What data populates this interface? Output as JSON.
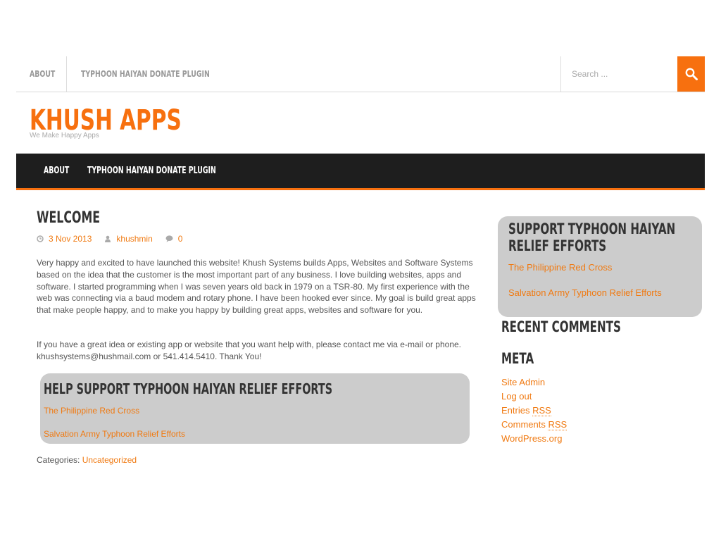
{
  "top_nav": {
    "items": [
      "About",
      "Typhoon Haiyan Donate Plugin"
    ],
    "search_placeholder": "Search ..."
  },
  "site": {
    "title": "Khush Apps",
    "tagline": "We Make Happy Apps"
  },
  "main_nav": {
    "items": [
      "About",
      "Typhoon Haiyan Donate Plugin"
    ]
  },
  "post": {
    "title": "Welcome",
    "date": "3 Nov 2013",
    "author": "khushmin",
    "comments": "0",
    "paragraphs": [
      "Very happy and excited to have launched this website! Khush Systems builds  Apps, Websites and Software Systems based on the idea that the customer is the most important part of any business. I love building websites, apps and software. I started programming when I was seven years old back in 1979 on a TSR-80. My first experience with the web was connecting via a baud modem and rotary phone. I have been hooked ever since.  My goal is build great apps that make people happy, and to make you happy by building great apps, websites and software for you.",
      "If you have a great idea or existing app or website that you want help with, please contact me via e-mail or phone.  khushsystems@hushmail.com or 541.414.5410. Thank You!"
    ],
    "relief_box": {
      "title": "Help Support Typhoon Haiyan Relief Efforts",
      "links": [
        "The Philippine Red Cross",
        "Salvation Army Typhoon Relief Efforts"
      ]
    },
    "categories_label": "Categories:",
    "category": "Uncategorized"
  },
  "sidebar": {
    "relief_box": {
      "title_line1": "Support Typhoon Haiyan",
      "title_line2": "Relief Efforts",
      "links": [
        "The Philippine Red Cross",
        "Salvation Army Typhoon Relief Efforts"
      ]
    },
    "recent_comments_title": "Recent Comments",
    "meta_title": "Meta",
    "meta_links": {
      "site_admin": "Site Admin",
      "log_out": "Log out",
      "entries": "Entries",
      "comments": "Comments",
      "rss": "RSS",
      "wordpress": "WordPress.org"
    }
  },
  "colors": {
    "accent": "#f7700f",
    "nav_bg": "#1e1e1e",
    "box_bg": "#cccccc"
  },
  "icons": {
    "search": "search-icon",
    "date": "clock-icon",
    "author": "user-icon",
    "comments": "comment-icon"
  }
}
